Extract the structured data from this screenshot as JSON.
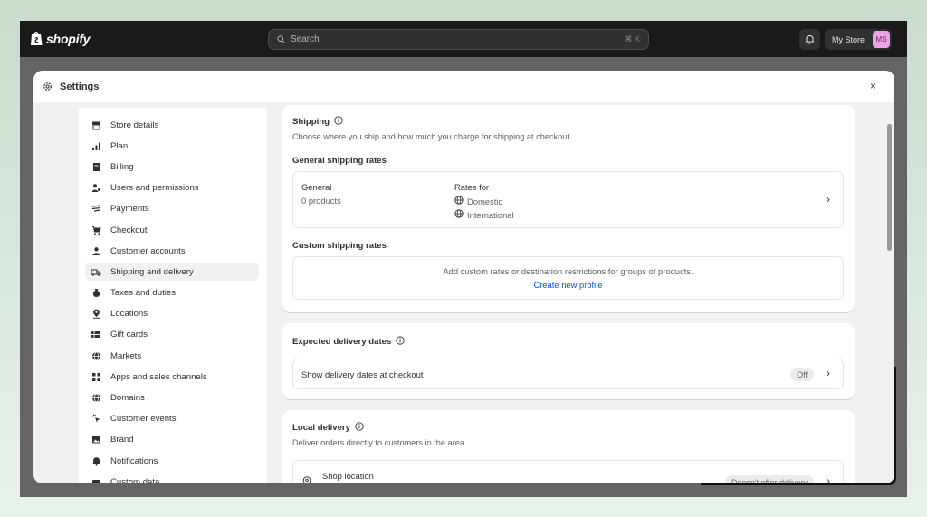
{
  "topbar": {
    "logo_text": "shopify",
    "search_placeholder": "Search",
    "search_shortcut": "⌘ K",
    "store_name": "My Store",
    "avatar_initials": "MS"
  },
  "modal": {
    "title": "Settings",
    "close_label": "×"
  },
  "nav": [
    {
      "label": "Store details",
      "icon": "store-icon"
    },
    {
      "label": "Plan",
      "icon": "plan-chart-icon"
    },
    {
      "label": "Billing",
      "icon": "billing-icon"
    },
    {
      "label": "Users and permissions",
      "icon": "users-icon"
    },
    {
      "label": "Payments",
      "icon": "payments-icon"
    },
    {
      "label": "Checkout",
      "icon": "cart-icon"
    },
    {
      "label": "Customer accounts",
      "icon": "person-icon"
    },
    {
      "label": "Shipping and delivery",
      "icon": "truck-icon",
      "active": true
    },
    {
      "label": "Taxes and duties",
      "icon": "tax-bag-icon"
    },
    {
      "label": "Locations",
      "icon": "location-pin-icon"
    },
    {
      "label": "Gift cards",
      "icon": "gift-card-icon"
    },
    {
      "label": "Markets",
      "icon": "globe-icon"
    },
    {
      "label": "Apps and sales channels",
      "icon": "apps-grid-icon"
    },
    {
      "label": "Domains",
      "icon": "globe-icon"
    },
    {
      "label": "Customer events",
      "icon": "cursor-click-icon"
    },
    {
      "label": "Brand",
      "icon": "brand-image-icon"
    },
    {
      "label": "Notifications",
      "icon": "bell-icon"
    },
    {
      "label": "Custom data",
      "icon": "custom-data-icon"
    }
  ],
  "shipping": {
    "title": "Shipping",
    "description": "Choose where you ship and how much you charge for shipping at checkout.",
    "general_rates_title": "General shipping rates",
    "general": {
      "name": "General",
      "products": "0 products",
      "rates_for_label": "Rates for",
      "zones": [
        "Domestic",
        "International"
      ]
    },
    "custom_rates_title": "Custom shipping rates",
    "custom_rates_text": "Add custom rates or destination restrictions for groups of products.",
    "create_profile_link": "Create new profile"
  },
  "delivery_dates": {
    "title": "Expected delivery dates",
    "row_label": "Show delivery dates at checkout",
    "status": "Off"
  },
  "local_delivery": {
    "title": "Local delivery",
    "description": "Deliver orders directly to customers in the area.",
    "location_name": "Shop location",
    "status": "Doesn't offer delivery"
  }
}
